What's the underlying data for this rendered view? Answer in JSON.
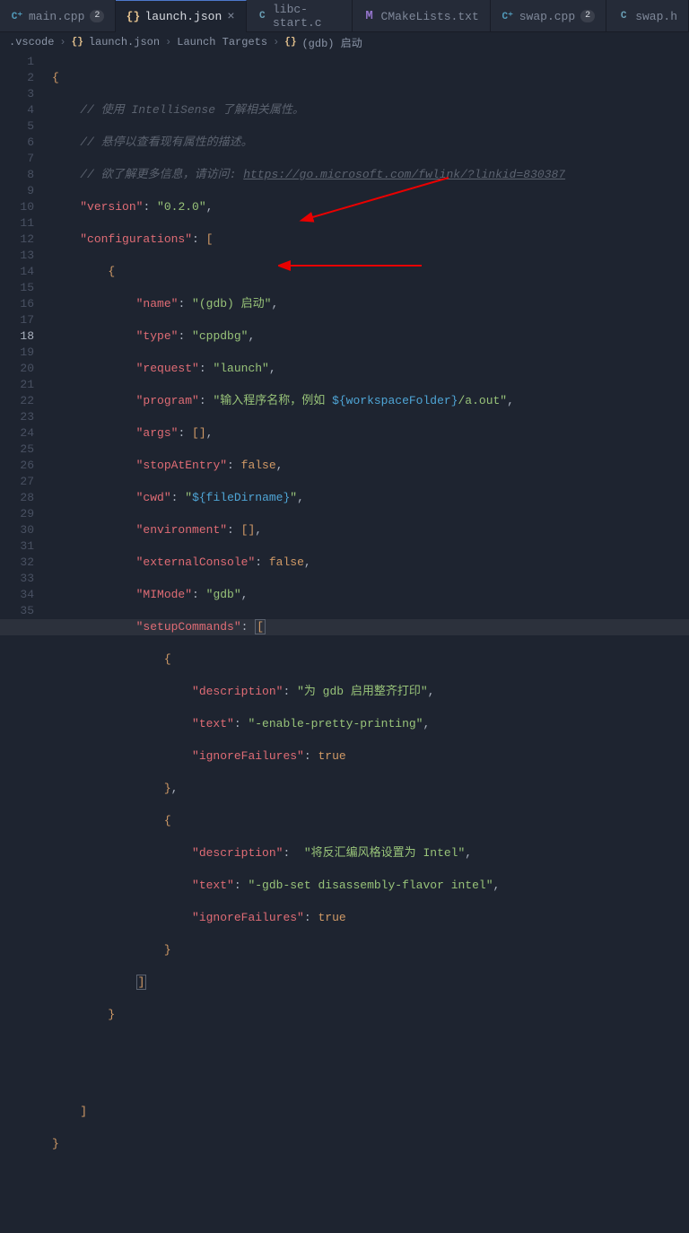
{
  "tabs": [
    {
      "label": "main.cpp",
      "badge": "2",
      "iconClass": "icon-cpp",
      "iconText": "C⁺"
    },
    {
      "label": "launch.json",
      "close": "×",
      "iconClass": "icon-json",
      "iconText": "{}"
    },
    {
      "label": "libc-start.c",
      "iconClass": "icon-c",
      "iconText": "C"
    },
    {
      "label": "CMakeLists.txt",
      "iconClass": "icon-m",
      "iconText": "M"
    },
    {
      "label": "swap.cpp",
      "badge": "2",
      "iconClass": "icon-cpp",
      "iconText": "C⁺"
    },
    {
      "label": "swap.h",
      "iconClass": "icon-c",
      "iconText": "C"
    }
  ],
  "breadcrumbs": {
    "b0": ".vscode",
    "b1": "launch.json",
    "b1icon": "{}",
    "b2": "Launch Targets",
    "b3": "(gdb) 启动",
    "b3icon": "{}"
  },
  "code": {
    "c1": "// 使用 IntelliSense 了解相关属性。",
    "c2": "// 悬停以查看现有属性的描述。",
    "c3a": "// 欲了解更多信息，请访问: ",
    "c3b": "https://go.microsoft.com/fwlink/?linkid=830387",
    "k_version": "\"version\"",
    "v_version": "\"0.2.0\"",
    "k_configs": "\"configurations\"",
    "k_name": "\"name\"",
    "v_name": "\"(gdb) 启动\"",
    "k_type": "\"type\"",
    "v_type": "\"cppdbg\"",
    "k_request": "\"request\"",
    "v_request": "\"launch\"",
    "k_program": "\"program\"",
    "v_program_a": "\"输入程序名称，例如 ",
    "v_program_b": "${workspaceFolder}",
    "v_program_c": "/a.out\"",
    "k_args": "\"args\"",
    "k_stop": "\"stopAtEntry\"",
    "v_false": "false",
    "k_cwd": "\"cwd\"",
    "v_cwd_a": "\"",
    "v_cwd_b": "${fileDirname}",
    "v_cwd_c": "\"",
    "k_env": "\"environment\"",
    "k_extcon": "\"externalConsole\"",
    "k_mimode": "\"MIMode\"",
    "v_mimode": "\"gdb\"",
    "k_setup": "\"setupCommands\"",
    "k_desc": "\"description\"",
    "v_desc1": "\"为 gdb 启用整齐打印\"",
    "k_text": "\"text\"",
    "v_text1": "\"-enable-pretty-printing\"",
    "k_ignore": "\"ignoreFailures\"",
    "v_true": "true",
    "v_desc2_a": "\"将反汇编风格设置为 Intel\"",
    "v_text2": "\"-gdb-set disassembly-flavor intel\""
  }
}
